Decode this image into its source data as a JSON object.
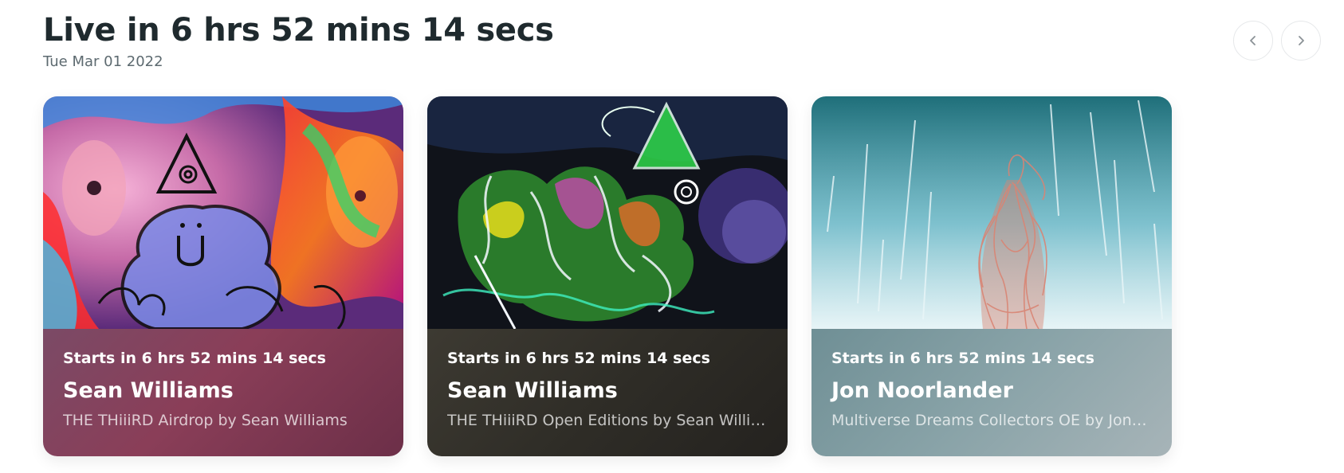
{
  "header": {
    "title": "Live in 6 hrs 52 mins 14 secs",
    "date": "Tue Mar 01 2022"
  },
  "nav": {
    "prev_icon": "chevron-left-icon",
    "next_icon": "chevron-right-icon"
  },
  "cards": [
    {
      "starts": "Starts in 6 hrs 52 mins 14 secs",
      "artist": "Sean Williams",
      "drop": "THE THiiiRD Airdrop by Sean Williams",
      "accent": "#8a3e58"
    },
    {
      "starts": "Starts in 6 hrs 52 mins 14 secs",
      "artist": "Sean Williams",
      "drop": "THE THiiiRD Open Editions by Sean Williams",
      "accent": "#2f2d27"
    },
    {
      "starts": "Starts in 6 hrs 52 mins 14 secs",
      "artist": "Jon Noorlander",
      "drop": "Multiverse Dreams Collectors OE by Jon Noorlander",
      "accent": "#89a3a8"
    }
  ]
}
